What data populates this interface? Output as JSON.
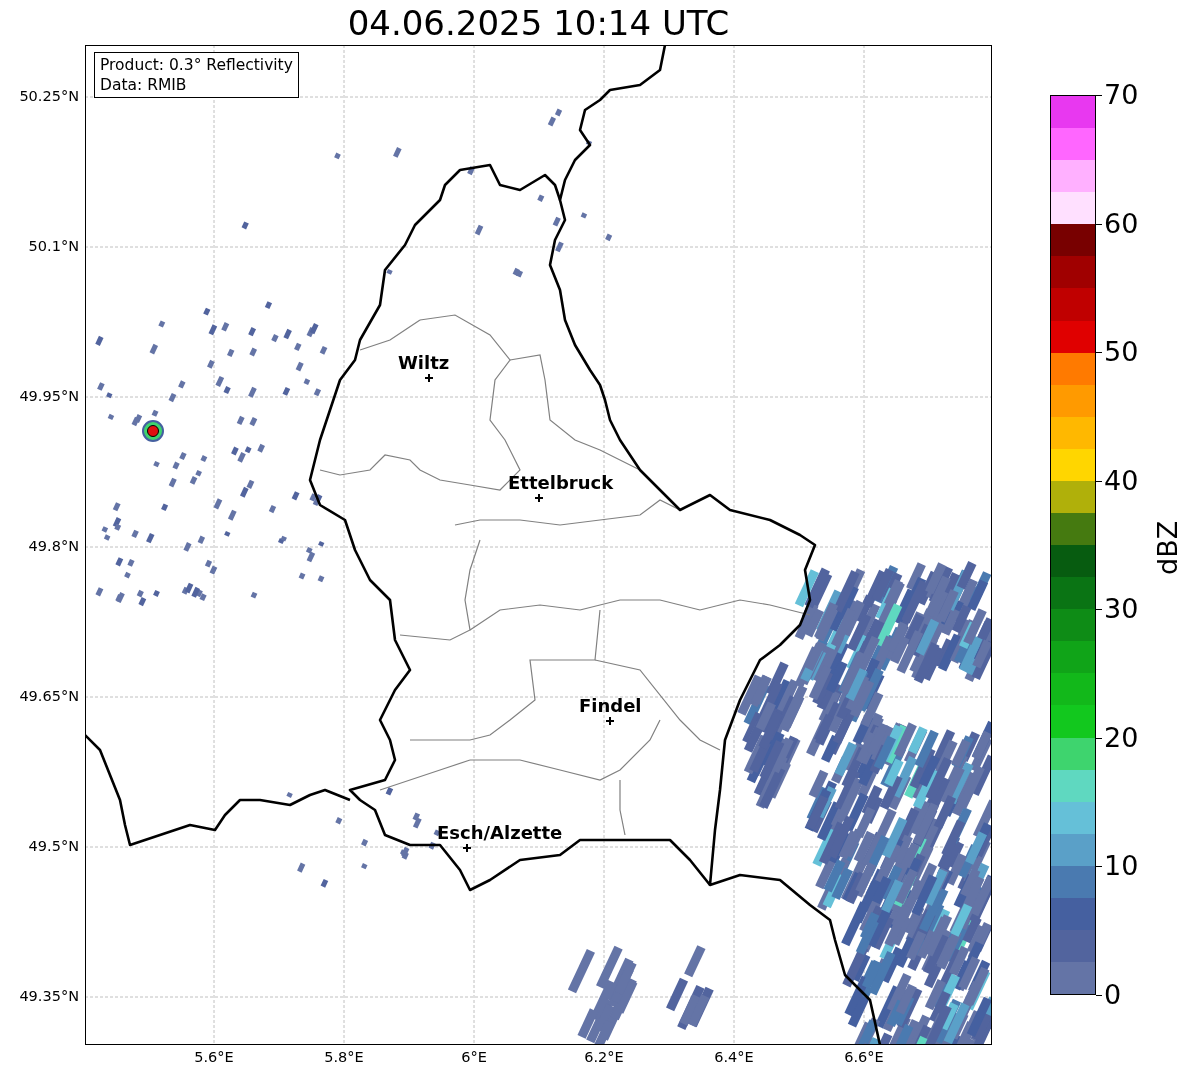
{
  "title": "04.06.2025 10:14 UTC",
  "info_box": {
    "lines": [
      "Product: 0.3° Reflectivity",
      "Data: RMIB"
    ]
  },
  "map": {
    "x_ticks": [
      "5.6°E",
      "5.8°E",
      "6°E",
      "6.2°E",
      "6.4°E",
      "6.6°E"
    ],
    "y_ticks": [
      "50.25°N",
      "50.1°N",
      "49.95°N",
      "49.8°N",
      "49.65°N",
      "49.5°N",
      "49.35°N"
    ],
    "places": [
      {
        "name": "Wiltz"
      },
      {
        "name": "Ettelbruck"
      },
      {
        "name": "Findel"
      },
      {
        "name": "Esch/Alzette"
      }
    ]
  },
  "colorbar": {
    "label": "dBZ",
    "ticks": [
      "70",
      "60",
      "50",
      "40",
      "30",
      "20",
      "10",
      "0"
    ],
    "levels": [
      {
        "color": "#e838f0"
      },
      {
        "color": "#ff66ff"
      },
      {
        "color": "#ffb0ff"
      },
      {
        "color": "#ffe0ff"
      },
      {
        "color": "#780000"
      },
      {
        "color": "#a00000"
      },
      {
        "color": "#c00000"
      },
      {
        "color": "#e00000"
      },
      {
        "color": "#ff7a00"
      },
      {
        "color": "#ff9a00"
      },
      {
        "color": "#ffb800"
      },
      {
        "color": "#ffd600"
      },
      {
        "color": "#b0b00a"
      },
      {
        "color": "#457a10"
      },
      {
        "color": "#075c10"
      },
      {
        "color": "#0a7414"
      },
      {
        "color": "#0e8c16"
      },
      {
        "color": "#10a418"
      },
      {
        "color": "#12b81a"
      },
      {
        "color": "#12c81e"
      },
      {
        "color": "#3ed46e"
      },
      {
        "color": "#5fd8c0"
      },
      {
        "color": "#65c0d8"
      },
      {
        "color": "#5aa0c8"
      },
      {
        "color": "#4a7ab0"
      },
      {
        "color": "#4560a0"
      },
      {
        "color": "#52649e"
      },
      {
        "color": "#6474a6"
      }
    ]
  }
}
